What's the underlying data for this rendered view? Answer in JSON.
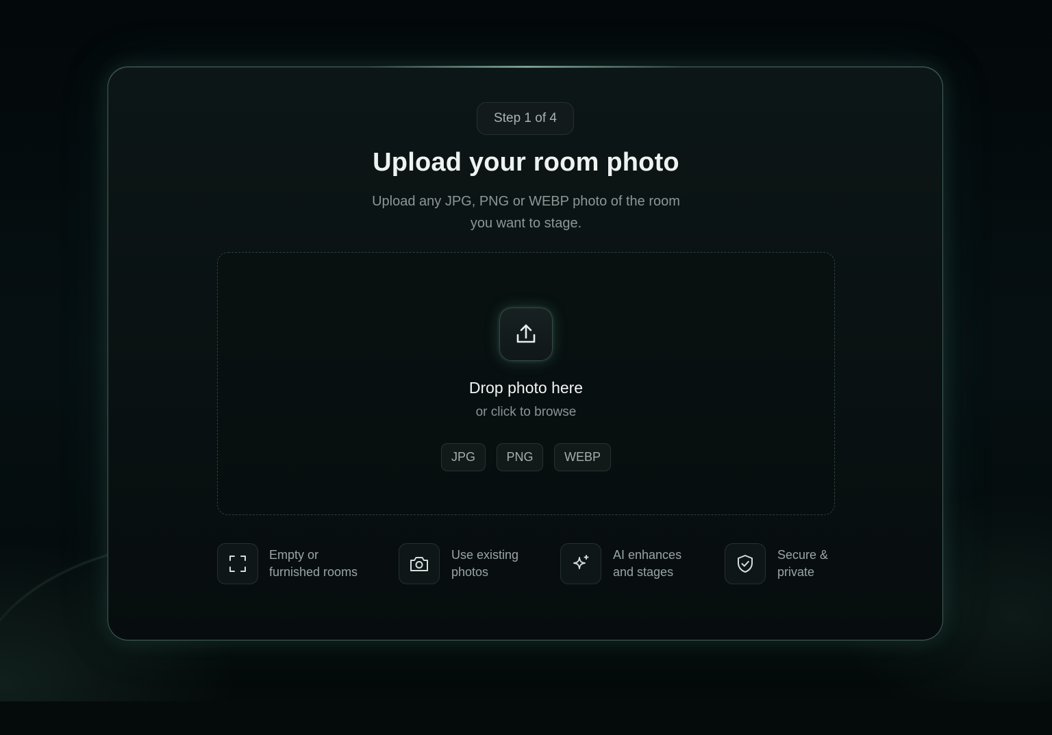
{
  "step": {
    "label": "Step 1 of 4"
  },
  "header": {
    "title": "Upload your room photo",
    "subtitle_line1": "Upload any JPG, PNG or WEBP photo of the room",
    "subtitle_line2": "you want to stage."
  },
  "dropzone": {
    "icon": "upload-icon",
    "title": "Drop photo here",
    "subtitle": "or click to browse",
    "formats": [
      "JPG",
      "PNG",
      "WEBP"
    ]
  },
  "features": [
    {
      "icon": "frame-corners-icon",
      "line1": "Empty or",
      "line2": "furnished rooms"
    },
    {
      "icon": "camera-icon",
      "line1": "Use existing",
      "line2": "photos"
    },
    {
      "icon": "sparkle-icon",
      "line1": "AI enhances",
      "line2": "and stages"
    },
    {
      "icon": "shield-check-icon",
      "line1": "Secure &",
      "line2": "private"
    }
  ],
  "colors": {
    "background": "#050a0b",
    "card": "#0b1314",
    "card_border_glow": "#8cbeac",
    "text_primary": "#eef2f1",
    "text_secondary": "#8c9796"
  }
}
